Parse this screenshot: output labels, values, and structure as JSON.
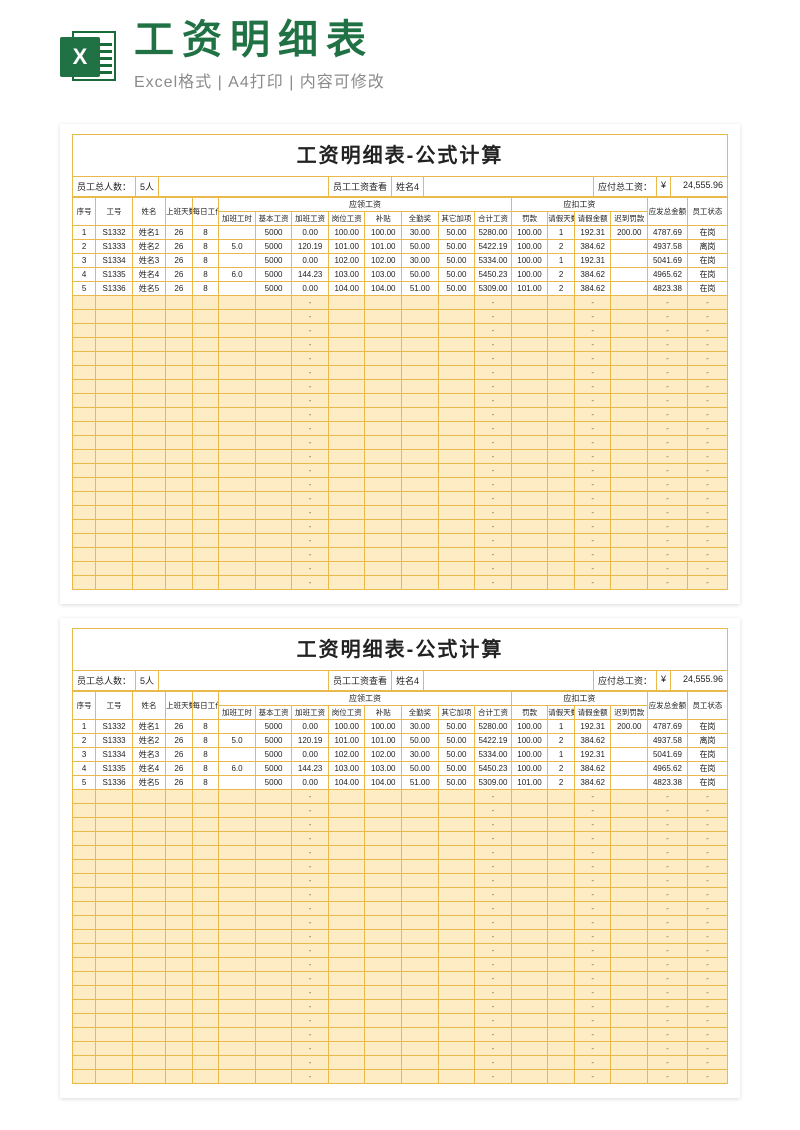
{
  "header": {
    "icon_letter": "X",
    "main": "工资明细表",
    "sub": "Excel格式 | A4打印 | 内容可修改"
  },
  "sheet": {
    "title": "工资明细表-公式计算",
    "summary": {
      "count_label": "员工总人数：",
      "count_value": "5人",
      "lookup_label": "员工工资查看",
      "lookup_value": "姓名4",
      "total_label": "应付总工资：",
      "total_cur": "¥",
      "total_value": "24,555.96"
    },
    "head": {
      "seq": "序号",
      "id": "工号",
      "name": "姓名",
      "days": "上班天数",
      "daily": "每日工作(h)",
      "group_due": "应领工资",
      "group_ded": "应扣工资",
      "ot_h": "加班工时",
      "base": "基本工资",
      "ot_pay": "加班工资",
      "post": "岗位工资",
      "allow": "补贴",
      "attend": "全勤奖",
      "other": "其它加项",
      "sum": "合计工资",
      "fine": "罚款",
      "leave": "请假天数",
      "leave_amt": "请假金额",
      "late": "迟到罚款",
      "net": "应发总金额",
      "status": "员工状态"
    },
    "rows": [
      {
        "seq": "1",
        "id": "S1332",
        "name": "姓名1",
        "days": "26",
        "daily": "8",
        "ot_h": "",
        "base": "5000",
        "ot_pay": "0.00",
        "post": "100.00",
        "allow": "100.00",
        "attend": "30.00",
        "other": "50.00",
        "sum": "5280.00",
        "fine": "100.00",
        "leave": "1",
        "leave_amt": "192.31",
        "late": "200.00",
        "net": "4787.69",
        "status": "在岗"
      },
      {
        "seq": "2",
        "id": "S1333",
        "name": "姓名2",
        "days": "26",
        "daily": "8",
        "ot_h": "5.0",
        "base": "5000",
        "ot_pay": "120.19",
        "post": "101.00",
        "allow": "101.00",
        "attend": "50.00",
        "other": "50.00",
        "sum": "5422.19",
        "fine": "100.00",
        "leave": "2",
        "leave_amt": "384.62",
        "late": "",
        "net": "4937.58",
        "status": "离岗"
      },
      {
        "seq": "3",
        "id": "S1334",
        "name": "姓名3",
        "days": "26",
        "daily": "8",
        "ot_h": "",
        "base": "5000",
        "ot_pay": "0.00",
        "post": "102.00",
        "allow": "102.00",
        "attend": "30.00",
        "other": "50.00",
        "sum": "5334.00",
        "fine": "100.00",
        "leave": "1",
        "leave_amt": "192.31",
        "late": "",
        "net": "5041.69",
        "status": "在岗"
      },
      {
        "seq": "4",
        "id": "S1335",
        "name": "姓名4",
        "days": "26",
        "daily": "8",
        "ot_h": "6.0",
        "base": "5000",
        "ot_pay": "144.23",
        "post": "103.00",
        "allow": "103.00",
        "attend": "50.00",
        "other": "50.00",
        "sum": "5450.23",
        "fine": "100.00",
        "leave": "2",
        "leave_amt": "384.62",
        "late": "",
        "net": "4965.62",
        "status": "在岗"
      },
      {
        "seq": "5",
        "id": "S1336",
        "name": "姓名5",
        "days": "26",
        "daily": "8",
        "ot_h": "",
        "base": "5000",
        "ot_pay": "0.00",
        "post": "104.00",
        "allow": "104.00",
        "attend": "51.00",
        "other": "50.00",
        "sum": "5309.00",
        "fine": "101.00",
        "leave": "2",
        "leave_amt": "384.62",
        "late": "",
        "net": "4823.38",
        "status": "在岗"
      }
    ],
    "blank_dash": "-",
    "blank_rows": 21
  }
}
